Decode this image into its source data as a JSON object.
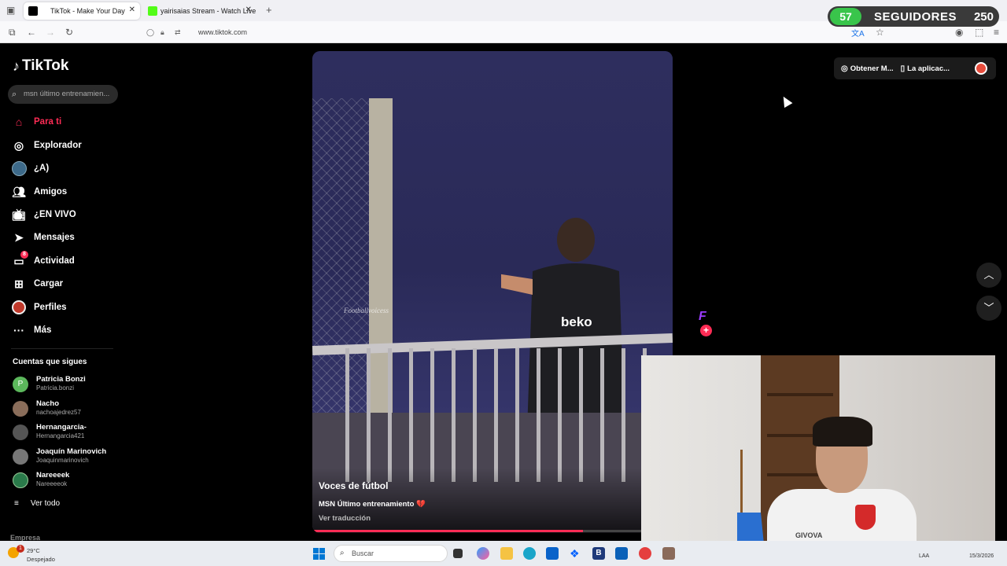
{
  "browser": {
    "tabs": [
      {
        "title": "TikTok - Make Your Day",
        "active": true
      },
      {
        "title": "yairisaias Stream - Watch Live o",
        "active": false
      }
    ],
    "url": "www.tiktok.com"
  },
  "overlay": {
    "followers_count": "57",
    "followers_label": "SEGUIDORES",
    "followers_goal": "250"
  },
  "sidebar": {
    "logo": "TikTok",
    "search_placeholder": "msn último entrenamien...",
    "nav": [
      {
        "label": "Para ti",
        "icon": "home-icon",
        "active": true
      },
      {
        "label": "Explorador",
        "icon": "compass-icon"
      },
      {
        "label": "¿A)",
        "icon": "avatar-icon"
      },
      {
        "label": "Amigos",
        "icon": "friends-icon"
      },
      {
        "label": "¿EN VIVO",
        "icon": "live-icon"
      },
      {
        "label": "Mensajes",
        "icon": "message-icon"
      },
      {
        "label": "Actividad",
        "icon": "activity-icon",
        "badge": "8"
      },
      {
        "label": "Cargar",
        "icon": "upload-icon"
      },
      {
        "label": "Perfiles",
        "icon": "profile-icon"
      },
      {
        "label": "Más",
        "icon": "more-icon"
      }
    ],
    "following_title": "Cuentas que sigues",
    "following": [
      {
        "name": "Patricia Bonzi",
        "username": "Patricia.bonzi",
        "initial": "P",
        "color": "#5cb85c"
      },
      {
        "name": "Nacho",
        "username": "nachoajedrez57",
        "color": "#8a6d5a"
      },
      {
        "name": "Hernangarcia-",
        "username": "Hernangarcia421",
        "color": "#555555"
      },
      {
        "name": "Joaquín Marinovich",
        "username": "Joaquinmarinovich",
        "color": "#777777"
      },
      {
        "name": "Nareeeek",
        "username": "Nareeeeok",
        "color": "#2a7a4a"
      }
    ],
    "see_all": "Ver todo",
    "footer": "Empresa"
  },
  "video": {
    "watermark": "Footballvoicess",
    "author": "Voces de fútbol",
    "caption": "MSN Último entrenamiento 💔",
    "translate": "Ver traducción",
    "progress": 0.75,
    "jersey_text": "beko"
  },
  "right_actions": {
    "get_coins": "Obtener M...",
    "app": "La aplicac..."
  },
  "webcam": {
    "shirt_brand": "GIVOVA"
  },
  "taskbar": {
    "weather_temp": "29°C",
    "weather_desc": "Despejado",
    "weather_badge": "1",
    "search_label": "Buscar",
    "lang": "LAA",
    "date": "15/3/2026"
  },
  "colors": {
    "accent": "#fe2c55",
    "followers_green": "#39c54b"
  }
}
